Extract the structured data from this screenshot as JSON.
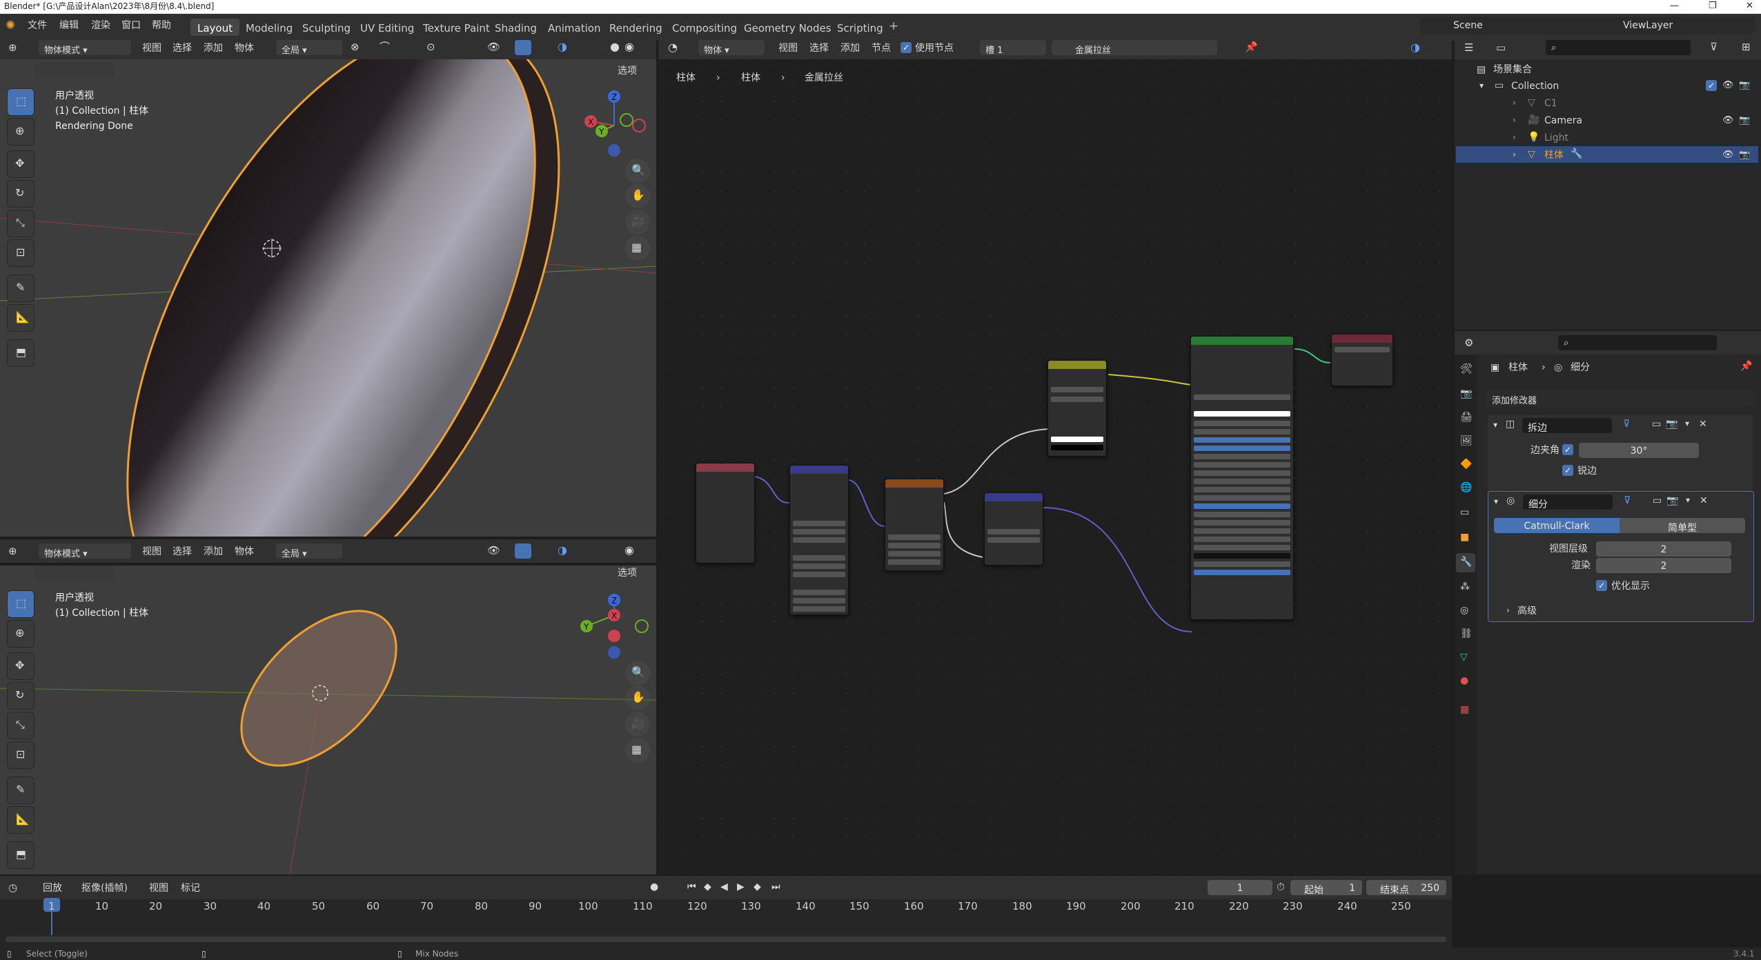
{
  "title_bar": {
    "text": "Blender* [G:\\产品设计Alan\\2023年\\8月份\\8.4\\.blend]"
  },
  "menu": {
    "items": [
      "文件",
      "编辑",
      "渲染",
      "窗口",
      "帮助"
    ]
  },
  "workspaces": [
    "Layout",
    "Modeling",
    "Sculpting",
    "UV Editing",
    "Texture Paint",
    "Shading",
    "Animation",
    "Rendering",
    "Compositing",
    "Geometry Nodes",
    "Scripting"
  ],
  "active_workspace": "Layout",
  "scene": {
    "name": "Scene",
    "view_layer": "ViewLayer"
  },
  "viewport_top": {
    "mode": "物体模式",
    "menus": [
      "视图",
      "选择",
      "添加",
      "物体"
    ],
    "orientation": "全局",
    "options": "选项",
    "info_line1": "用户透视",
    "info_line2": "(1) Collection | 柱体",
    "info_line3": "Rendering Done",
    "gizmo": {
      "x": "X",
      "y": "Y",
      "z": "Z"
    }
  },
  "viewport_bottom": {
    "mode": "物体模式",
    "menus": [
      "视图",
      "选择",
      "添加",
      "物体"
    ],
    "orientation": "全局",
    "options": "选项",
    "info_line1": "用户透视",
    "info_line2": "(1) Collection | 柱体",
    "gizmo": {
      "x": "X",
      "y": "Y",
      "z": "Z"
    }
  },
  "node_editor": {
    "type": "物体",
    "menus": [
      "视图",
      "选择",
      "添加",
      "节点"
    ],
    "use_nodes": "使用节点",
    "slot": "槽 1",
    "material": "金属拉丝",
    "breadcrumb": [
      "柱体",
      "柱体",
      "金属拉丝"
    ]
  },
  "outliner": {
    "root": "场景集合",
    "collection": "Collection",
    "items": [
      {
        "name": "C1",
        "color": "#8a8a5a"
      },
      {
        "name": "Camera",
        "color": "#e0a070"
      },
      {
        "name": "Light",
        "color": "#8a8a5a"
      },
      {
        "name": "柱体",
        "color": "#e8a050",
        "selected": true
      }
    ]
  },
  "properties": {
    "breadcrumb": [
      "柱体",
      "细分"
    ],
    "add_modifier": "添加修改器",
    "bevel": {
      "name": "拆边",
      "angle_label": "边夹角",
      "angle_value": "30°",
      "sharp_label": "锐边"
    },
    "subsurf": {
      "name": "细分",
      "catmull": "Catmull-Clark",
      "simple": "简单型",
      "viewport_label": "视图层级",
      "viewport_value": "2",
      "render_label": "渲染",
      "render_value": "2",
      "optimal_label": "优化显示",
      "advanced": "高级"
    }
  },
  "timeline": {
    "menus": [
      "回放",
      "抠像(插帧)",
      "视图",
      "标记"
    ],
    "current_frame": "1",
    "start_label": "起始",
    "start": "1",
    "end_label": "结束点",
    "end": "250",
    "ticks": [
      "1",
      "10",
      "20",
      "30",
      "40",
      "50",
      "60",
      "70",
      "80",
      "90",
      "100",
      "110",
      "120",
      "130",
      "140",
      "150",
      "160",
      "170",
      "180",
      "190",
      "200",
      "210",
      "220",
      "230",
      "240",
      "250"
    ]
  },
  "status_bar": {
    "left": "Select (Toggle)",
    "middle": "Mix Nodes",
    "version": "3.4.1"
  },
  "colors": {
    "accent": "#4772b3",
    "selection_orange": "#f0a030",
    "header": "#303030"
  }
}
